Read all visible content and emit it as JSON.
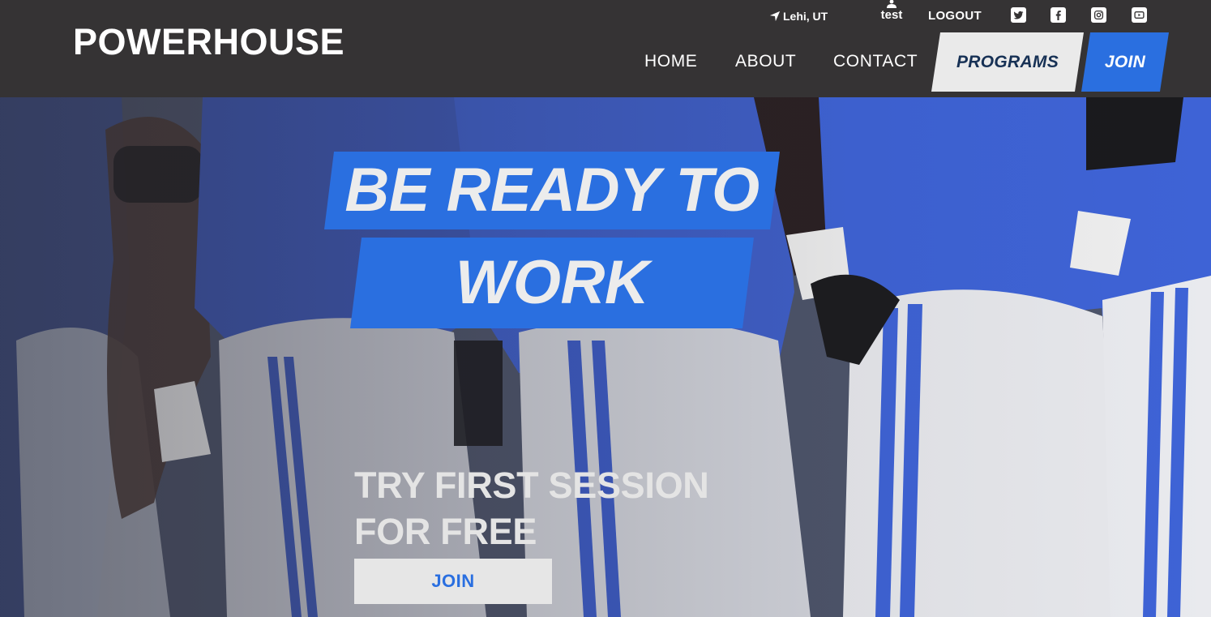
{
  "brand": {
    "name": "POWERHOUSE"
  },
  "utility": {
    "location": "Lehi, UT",
    "username": "test",
    "logout_label": "LOGOUT",
    "social_icons": [
      "twitter-icon",
      "facebook-icon",
      "instagram-icon",
      "youtube-icon"
    ]
  },
  "nav": {
    "home": "HOME",
    "about": "ABOUT",
    "contact": "CONTACT",
    "programs": "PROGRAMS",
    "join": "JOIN"
  },
  "hero": {
    "headline_line1": "BE READY TO",
    "headline_line2": "WORK",
    "cta_line1": "TRY FIRST SESSION",
    "cta_line2": "FOR FREE",
    "cta_button": "JOIN"
  },
  "colors": {
    "header_bg": "#353334",
    "accent_blue": "#2a6fe0",
    "programs_bg": "#eaeaea",
    "programs_text": "#173155",
    "hero_text": "#ececec"
  }
}
